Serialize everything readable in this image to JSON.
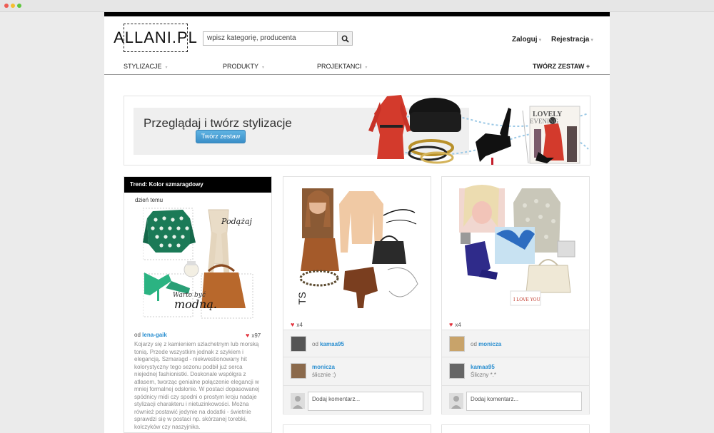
{
  "logo": "ALLANI.PL",
  "search": {
    "placeholder": "wpisz kategorię, producenta"
  },
  "auth": {
    "login": "Zaloguj",
    "register": "Rejestracja"
  },
  "nav": {
    "items": [
      "STYLIZACJE",
      "PRODUKTY",
      "PROJEKTANCI"
    ],
    "create": "TWÓRZ ZESTAW +"
  },
  "banner": {
    "title": "Przeglądaj i twórz stylizacje",
    "button": "Twórz zestaw"
  },
  "trend": {
    "header": "Trend: Kolor szmaragdowy",
    "time": "dzień temu",
    "author_prefix": "od",
    "author": "lena-gaik",
    "likes": "x97",
    "collage_text_1": "Podążaj za trendami!",
    "collage_text_2": "Warto być",
    "collage_text_3": "modną.",
    "text": "Kojarzy się z kamieniem szlachetnym lub morską tonią. Przede wszystkim jednak z szykiem i elegancją. Szmaragd - niekwestionowany hit kolorystyczny tego sezonu podbił już serca niejednej fashionistki. Doskonale współgra z atłasem, tworząc genialne połączenie elegancji w mniej formalnej odsłonie. W postaci dopasowanej spódnicy midi czy spodni o prostym kroju nadaje stylizacji charakteru i nietuzinkowości. Można również postawić jedynie na dodatki - świetnie sprawdzi się w postaci np. skórzanej torebki, kolczyków czy naszyjnika."
  },
  "posts": [
    {
      "likes": "x4",
      "od": "od",
      "author": "kamaa95",
      "commenter": "monicza",
      "comment": "ślicznie :)",
      "comment_placeholder": "Dodaj komentarz..."
    },
    {
      "likes": "x4",
      "od": "od",
      "author": "monicza",
      "commenter": "kamaa95",
      "comment": "Śliczny *.*",
      "comment_placeholder": "Dodaj komentarz...",
      "collage_note": "I LOVE YOU"
    }
  ],
  "colors": {
    "accent": "#2b8fd0",
    "button": "#4aa3da",
    "heart": "#e2323c",
    "black": "#000000"
  }
}
